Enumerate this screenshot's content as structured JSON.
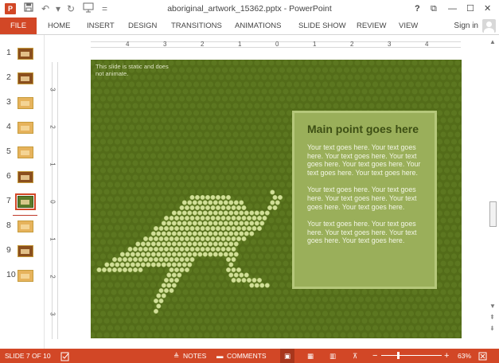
{
  "app": {
    "title": "aboriginal_artwork_15362.pptx - PowerPoint",
    "logo": "P",
    "qa_icons": [
      "save-icon",
      "undo-icon",
      "redo-icon",
      "start-from-beginning-icon",
      "customize-icon"
    ],
    "window_controls": [
      "?",
      "⧉",
      "—",
      "☐",
      "✕"
    ]
  },
  "ribbon": {
    "tabs": [
      "FILE",
      "HOME",
      "INSERT",
      "DESIGN",
      "TRANSITIONS",
      "ANIMATIONS",
      "SLIDE SHOW",
      "REVIEW",
      "VIEW"
    ],
    "signin": "Sign in"
  },
  "thumbnails": {
    "items": [
      {
        "num": "1",
        "style": "dark"
      },
      {
        "num": "2",
        "style": "dark"
      },
      {
        "num": "3",
        "style": "light"
      },
      {
        "num": "4",
        "style": "light"
      },
      {
        "num": "5",
        "style": "light"
      },
      {
        "num": "6",
        "style": "dark"
      },
      {
        "num": "7",
        "style": "green"
      },
      {
        "num": "8",
        "style": "light"
      },
      {
        "num": "9",
        "style": "dark"
      },
      {
        "num": "10",
        "style": "light"
      }
    ],
    "active_index": 6
  },
  "ruler": {
    "h_labels": [
      "4",
      "3",
      "2",
      "1",
      "0",
      "1",
      "2",
      "3",
      "4"
    ],
    "v_labels": [
      "3",
      "2",
      "1",
      "0",
      "1",
      "2",
      "3"
    ]
  },
  "slide": {
    "note": "This slide is static and does not animate.",
    "title": "Main point goes here",
    "para1": "Your text goes here. Your text goes here. Your text goes here. Your text goes here. Your text goes here. Your text goes here. Your text goes here.",
    "para2": "Your text goes here. Your text goes here. Your text goes here. Your text goes here. Your text goes here.",
    "para3": "Your text goes here. Your text goes here. Your text goes here. Your text goes here. Your text goes here.",
    "colors": {
      "background": "#536c19",
      "box": "#9aaf5a",
      "kangaroo_dots": "#d2e099"
    }
  },
  "status": {
    "slide_info": "SLIDE 7 OF 10",
    "notes": "NOTES",
    "comments": "COMMENTS",
    "zoom": "63%",
    "zoom_minus": "−",
    "zoom_plus": "+",
    "view_icons": [
      "normal-view-icon",
      "slide-sorter-icon",
      "reading-view-icon",
      "slide-show-icon"
    ]
  }
}
